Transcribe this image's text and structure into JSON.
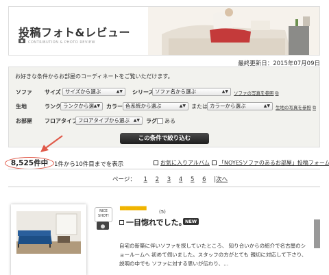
{
  "header": {
    "title": "投稿フォト&レビュー",
    "subtitle": "CONTRIBUTION & PHOTO REVIEW"
  },
  "updated": "最終更新日：2015年07月09日",
  "search": {
    "intro": "お好きな条件からお部屋のコーディネートをご覧いただけます。",
    "rows": [
      {
        "label": "ソファ",
        "fields": [
          {
            "label": "サイズ",
            "value": "サイズから選ぶ"
          },
          {
            "label": "シリーズ",
            "value": "ソファ名から選ぶ"
          }
        ],
        "link": "ソファの写真を参照"
      },
      {
        "label": "生地",
        "fields": [
          {
            "label": "ランク",
            "value": "ランクから選"
          },
          {
            "label": "カラー",
            "value": "色系統から選ぶ"
          },
          {
            "label": "または",
            "value": "カラーから選ぶ"
          }
        ],
        "link": "生地の写真を参照"
      },
      {
        "label": "お部屋",
        "fields": [
          {
            "label": "フロアタイプ",
            "value": "フロアタイプから選ぶ"
          },
          {
            "label": "ラグ",
            "value": "ある"
          }
        ]
      }
    ],
    "submit": "この条件で絞り込む"
  },
  "results": {
    "count": "8,525件中",
    "range": "1件から10件目までを表示",
    "links": [
      "お気に入りアルバム",
      "「NOYESソファのあるお部屋」投稿フォーム"
    ]
  },
  "pager": {
    "label": "ページ：",
    "pages": [
      "1",
      "2",
      "3",
      "4",
      "5",
      "6"
    ],
    "next": "|次へ"
  },
  "review": {
    "badge": "NICE SHOT!",
    "star_count": "(5)",
    "rating": 5,
    "title": "一目惚れでした。",
    "new_label": "NEW",
    "body": "自宅の新築に伴いソファを探していたところ、 知り合いからの紹介で名古屋のショールームへ 初めて伺いました。スタッフの方がとても 親切に対応して下さり、 説明の中でも ソファに対する思いが伝わり、..."
  },
  "colors": {
    "accent_red": "#e05a4a",
    "star": "#f0b400",
    "panel_bg": "#f2f2ee"
  }
}
